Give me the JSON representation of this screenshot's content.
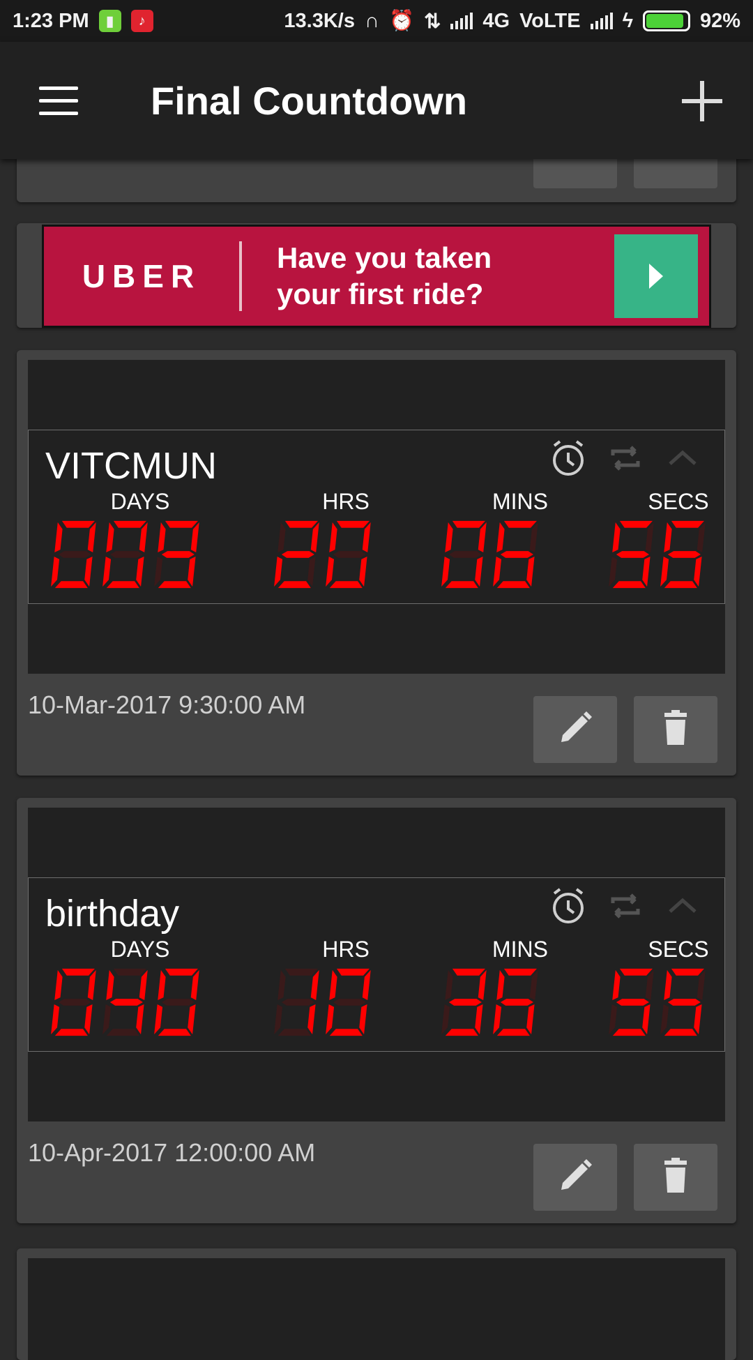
{
  "status_bar": {
    "time": "1:23 PM",
    "net_speed": "13.3K/s",
    "network": "4G",
    "volte": "VoLTE",
    "battery": "92%"
  },
  "app_bar": {
    "title": "Final Countdown",
    "menu_icon": "hamburger-menu-icon",
    "add_icon": "plus-icon"
  },
  "ad": {
    "brand": "UBER",
    "headline_line1": "Have you taken",
    "headline_line2": "your first ride?",
    "color": "#b8143f",
    "cta_color": "#37b487"
  },
  "labels": {
    "days": "DAYS",
    "hrs": "HRS",
    "mins": "MINS",
    "secs": "SECS"
  },
  "events": [
    {
      "name": "VITCMUN",
      "days": "009",
      "hrs": "20",
      "mins": "06",
      "secs": "56",
      "date": "10-Mar-2017 9:30:00 AM"
    },
    {
      "name": "birthday",
      "days": "040",
      "hrs": "10",
      "mins": "36",
      "secs": "55",
      "date": "10-Apr-2017 12:00:00 AM"
    }
  ],
  "colors": {
    "digit_on": "#ff0000",
    "digit_off": "#3a1a1a",
    "card": "#424242",
    "panel": "#212121"
  }
}
